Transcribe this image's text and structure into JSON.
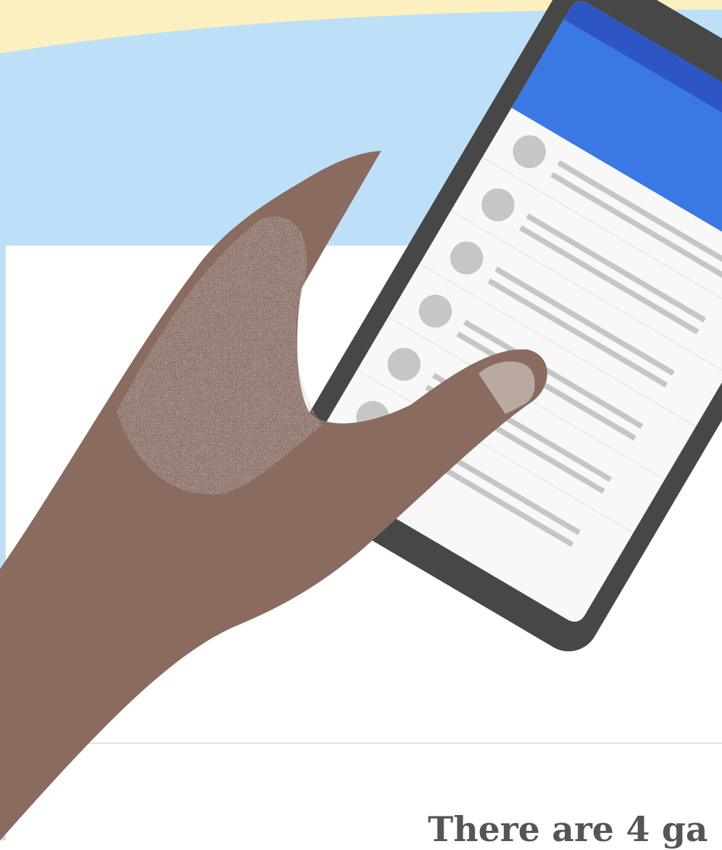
{
  "colors": {
    "sky": "#bde0f8",
    "sun_band": "#fdf0c0",
    "card": "#ffffff",
    "card_border": "#dde1e4",
    "phone_body": "#474747",
    "app_bar": "#3a78e4",
    "status_bar": "#2d56c4",
    "screen": "#f8f8f8",
    "avatar": "#c6c6c6",
    "text_line": "#c6c6c6",
    "fab": "#dd4537",
    "skin": "#8a6b5f",
    "skin_texture": "#a08a7e",
    "nail": "#b9a9a1",
    "caption_text": "#555555"
  },
  "caption": {
    "text": "There are 4 ga"
  },
  "icons": {
    "camera": "camera-dot-icon",
    "fab": "fab-icon"
  }
}
